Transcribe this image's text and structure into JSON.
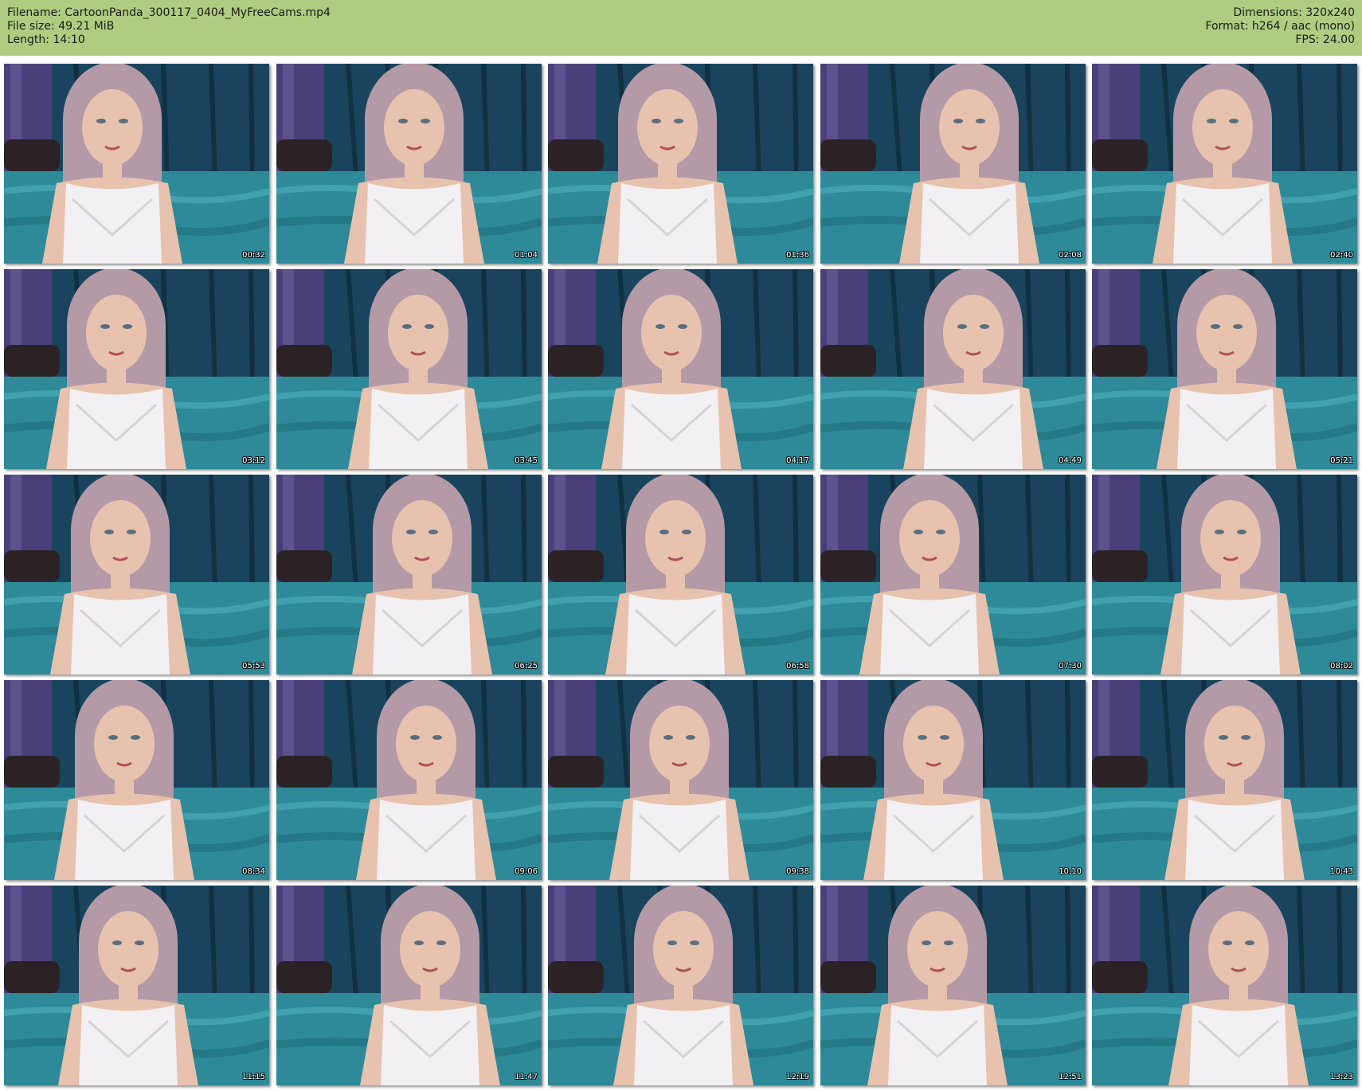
{
  "header": {
    "left_lines": [
      "Filename: CartoonPanda_300117_0404_MyFreeCams.mp4",
      "File size: 49.21 MiB",
      "Length: 14:10"
    ],
    "right_lines": [
      "Dimensions: 320x240",
      "Format: h264 / aac (mono)",
      "FPS: 24.00"
    ]
  },
  "colors": {
    "header_bg": "#b0cc80",
    "wall": "#4a3f78",
    "curtain": "#163a4e",
    "bed": "#2e8a98",
    "hair": "#b49aa6",
    "skin": "#e7c2ae",
    "top": "#f2f0f2"
  },
  "thumbnails": [
    {
      "timestamp": "00:32"
    },
    {
      "timestamp": "01:04"
    },
    {
      "timestamp": "01:36"
    },
    {
      "timestamp": "02:08"
    },
    {
      "timestamp": "02:40"
    },
    {
      "timestamp": "03:12"
    },
    {
      "timestamp": "03:45"
    },
    {
      "timestamp": "04:17"
    },
    {
      "timestamp": "04:49"
    },
    {
      "timestamp": "05:21"
    },
    {
      "timestamp": "05:53"
    },
    {
      "timestamp": "06:25"
    },
    {
      "timestamp": "06:58"
    },
    {
      "timestamp": "07:30"
    },
    {
      "timestamp": "08:02"
    },
    {
      "timestamp": "08:34"
    },
    {
      "timestamp": "09:06"
    },
    {
      "timestamp": "09:38"
    },
    {
      "timestamp": "10:10"
    },
    {
      "timestamp": "10:43"
    },
    {
      "timestamp": "11:15"
    },
    {
      "timestamp": "11:47"
    },
    {
      "timestamp": "12:19"
    },
    {
      "timestamp": "12:51"
    },
    {
      "timestamp": "13:23"
    }
  ]
}
